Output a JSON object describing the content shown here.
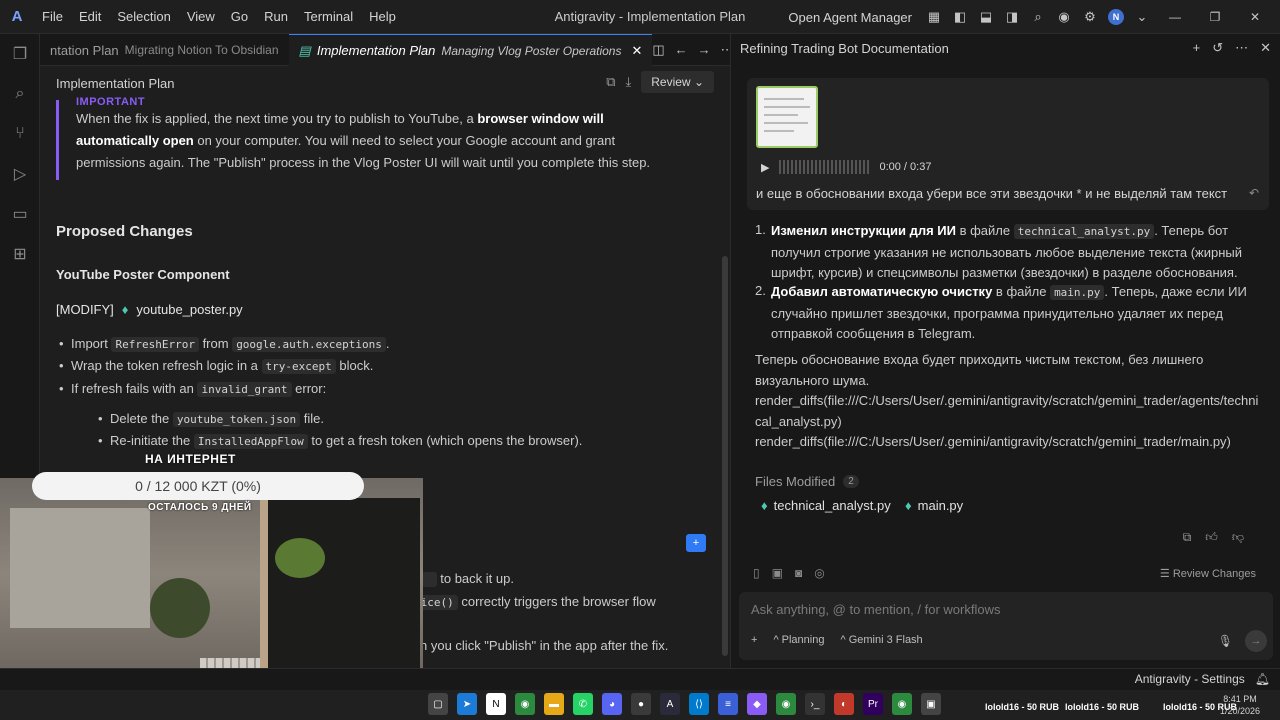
{
  "titlebar": {
    "menu": [
      "File",
      "Edit",
      "Selection",
      "View",
      "Go",
      "Run",
      "Terminal",
      "Help"
    ],
    "window_title": "Antigravity - Implementation Plan",
    "agent_manager": "Open Agent Manager",
    "avatar_letter": "N"
  },
  "tabs": [
    {
      "label": "ntation Plan",
      "sub": "Migrating Notion To Obsidian"
    },
    {
      "label": "Implementation Plan",
      "sub": "Managing Vlog Poster Operations"
    }
  ],
  "editor": {
    "doc_title": "Implementation Plan",
    "review_label": "Review",
    "callout_label": "IMPORTANT",
    "callout_line1_a": "When the fix is applied, the next time you try to publish to YouTube, a ",
    "callout_line1_b": "browser window will",
    "callout_line2_a": "automatically open",
    "callout_line2_b": " on your computer. You will need to select your Google account and grant",
    "callout_line3": "permissions again. The \"Publish\" process in the Vlog Poster UI will wait until you complete this step.",
    "proposed_changes": "Proposed Changes",
    "component": "YouTube Poster Component",
    "modify_tag": "[MODIFY]",
    "modify_file": "youtube_poster.py",
    "b1_a": "Import ",
    "b1_code1": "RefreshError",
    "b1_b": " from ",
    "b1_code2": "google.auth.exceptions",
    "b1_c": ".",
    "b2_a": "Wrap the token refresh logic in a ",
    "b2_code": "try-except",
    "b2_b": " block.",
    "b3_a": "If refresh fails with an ",
    "b3_code": "invalid_grant",
    "b3_b": " error:",
    "b4_a": "Delete the ",
    "b4_code": "youtube_token.json",
    "b4_b": " file.",
    "b5_a": "Re-initiate the ",
    "b5_code": "InstalledAppFlow",
    "b5_b": " to get a fresh token (which opens the browser).",
    "partial1": " to back it up.",
    "partial2_code": "vice()",
    "partial2_b": " correctly triggers the browser flow",
    "partial3": "n you click \"Publish\" in the app after the fix."
  },
  "overlay": {
    "internet_label": "НА ИНТЕРНЕТ",
    "progress_text": "0 / 12 000 KZT (0%)",
    "progress_value": 0,
    "days_left": "ОСТАЛОСЬ 9 ДНЕЙ"
  },
  "panel": {
    "title": "Refining Trading Bot Documentation",
    "audio_time": "0:00 / 0:37",
    "user_text": "и еще в обосновании входа убери все эти звездочки * и не выделяй там текст",
    "item1_num": "1.",
    "item1_bold": "Изменил инструкции для ИИ",
    "item1_a": " в файле ",
    "item1_code": "technical_analyst.py",
    "item1_b": ". Теперь бот",
    "item1_line2": "получил строгие указания не использовать любое выделение текста (жирный",
    "item1_line3": "шрифт, курсив) и спецсимволы разметки (звездочки) в разделе обоснования.",
    "item2_num": "2.",
    "item2_bold": "Добавил автоматическую очистку",
    "item2_a": " в файле ",
    "item2_code": "main.py",
    "item2_b": ". Теперь, даже если ИИ",
    "item2_line2": "случайно пришлет звездочки, программа принудительно удаляет их перед",
    "item2_line3": "отправкой сообщения в Telegram.",
    "para1": "Теперь обоснование входа будет приходить чистым текстом, без лишнего",
    "para2": "визуального шума.",
    "diff1a": "render_diffs(file:///C:/Users/User/.gemini/antigravity/scratch/gemini_trader/agents/techni",
    "diff1b": "cal_analyst.py)",
    "diff2": "render_diffs(file:///C:/Users/User/.gemini/antigravity/scratch/gemini_trader/main.py)",
    "files_modified": "Files Modified",
    "files_count": "2",
    "file1": "technical_analyst.py",
    "file2": "main.py",
    "review_changes": "Review Changes",
    "input_placeholder": "Ask anything, @ to mention, / for workflows",
    "mode": "Planning",
    "model": "Gemini 3 Flash"
  },
  "statusbar": {
    "settings": "Antigravity - Settings"
  },
  "taskbar": {
    "donation1": "lolold16 - 50 RUB",
    "donation2": "lolold16 - 50 RUB",
    "donation3": "lolold16 - 50 RUB",
    "lang": "РУС",
    "time": "8:41 PM",
    "date": "1/20/2026"
  }
}
